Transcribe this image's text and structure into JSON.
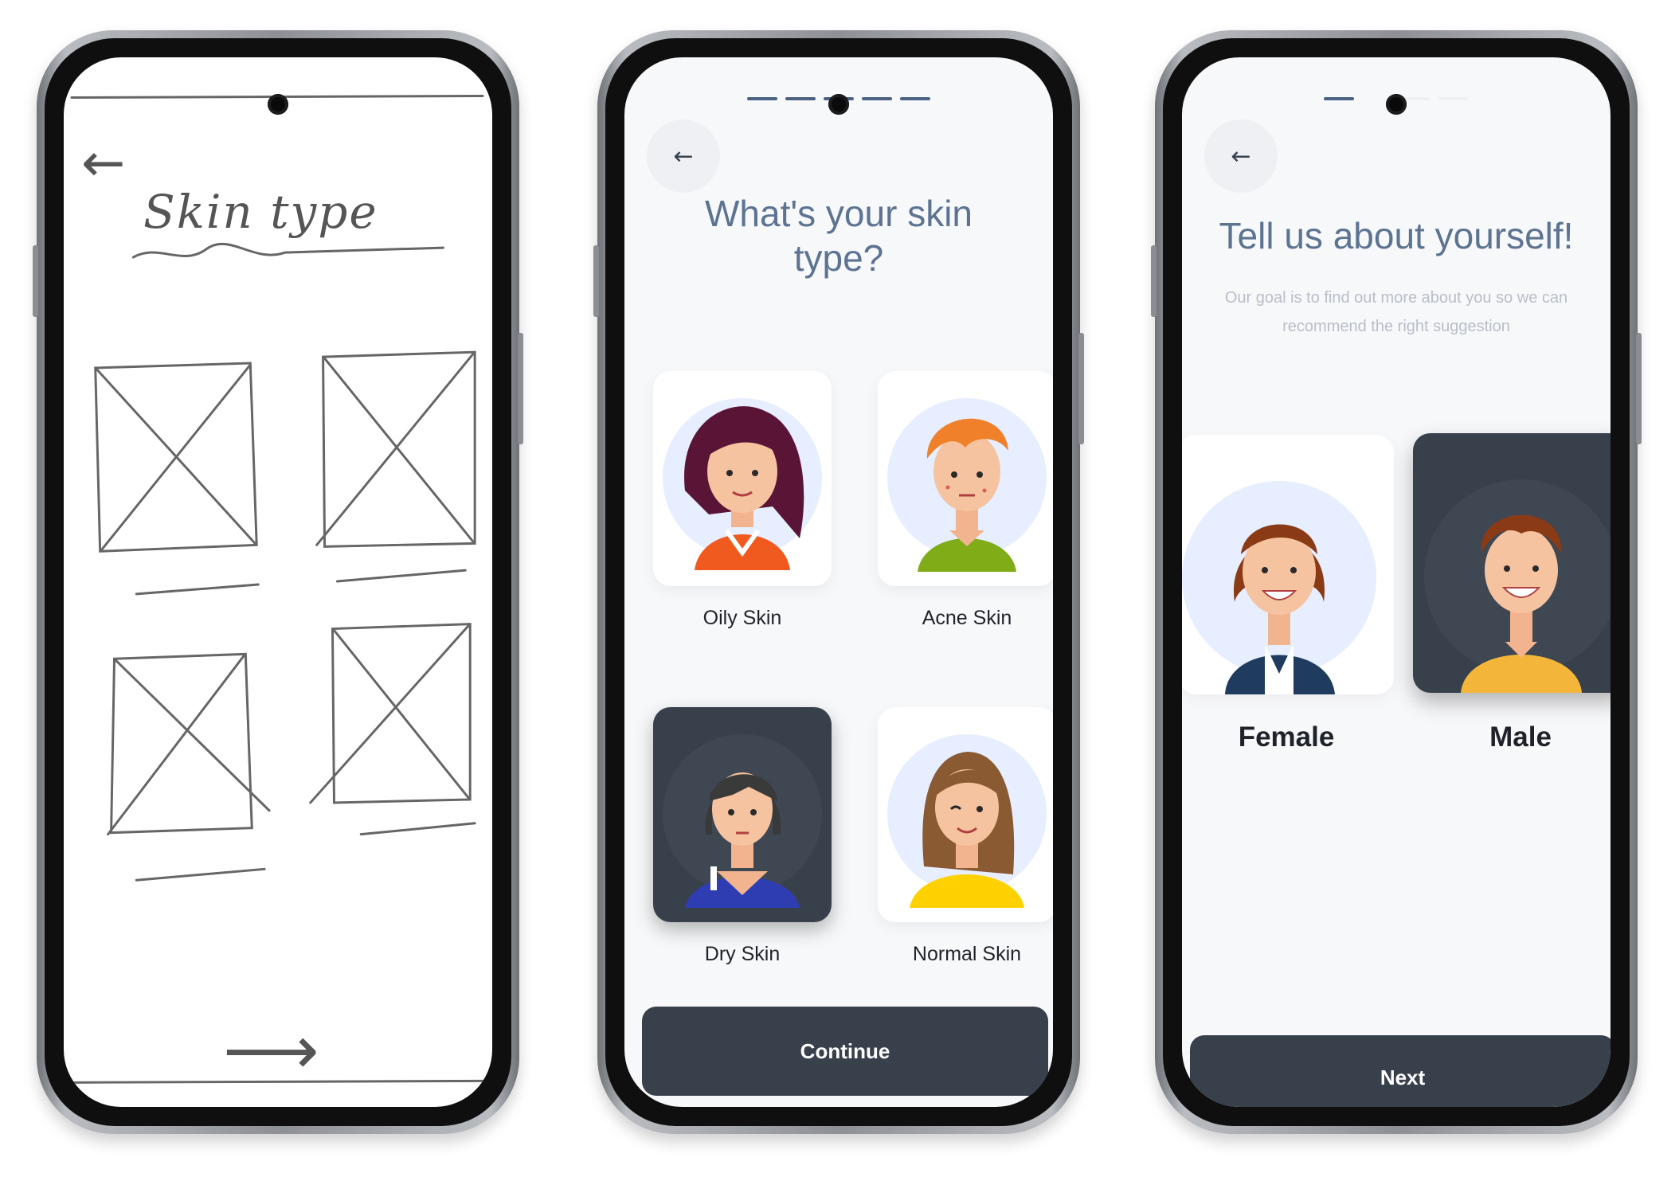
{
  "screens": {
    "sketch": {
      "title": "Skin type",
      "back_glyph": "←",
      "next_glyph": "⟶"
    },
    "skin_type": {
      "title": "What's your skin type?",
      "back_glyph": "←",
      "options": [
        {
          "label": "Oily Skin",
          "selected": false
        },
        {
          "label": "Acne Skin",
          "selected": false
        },
        {
          "label": "Dry Skin",
          "selected": true
        },
        {
          "label": "Normal Skin",
          "selected": false
        }
      ],
      "continue_label": "Continue"
    },
    "about": {
      "title": "Tell us about yourself!",
      "subtitle": "Our goal is to find out more about you so we can recommend the right suggestion",
      "back_glyph": "←",
      "options": [
        {
          "label": "Female",
          "selected": false
        },
        {
          "label": "Male",
          "selected": true
        }
      ],
      "next_label": "Next"
    }
  },
  "icons": {
    "back": "arrow-left-icon",
    "camera": "front-camera-icon"
  },
  "colors": {
    "primary": "#38404b",
    "title": "#5c7392",
    "muted": "#b8bec8",
    "screen_bg": "#f7f8fa",
    "avatar_circle": "#e6eeff"
  }
}
